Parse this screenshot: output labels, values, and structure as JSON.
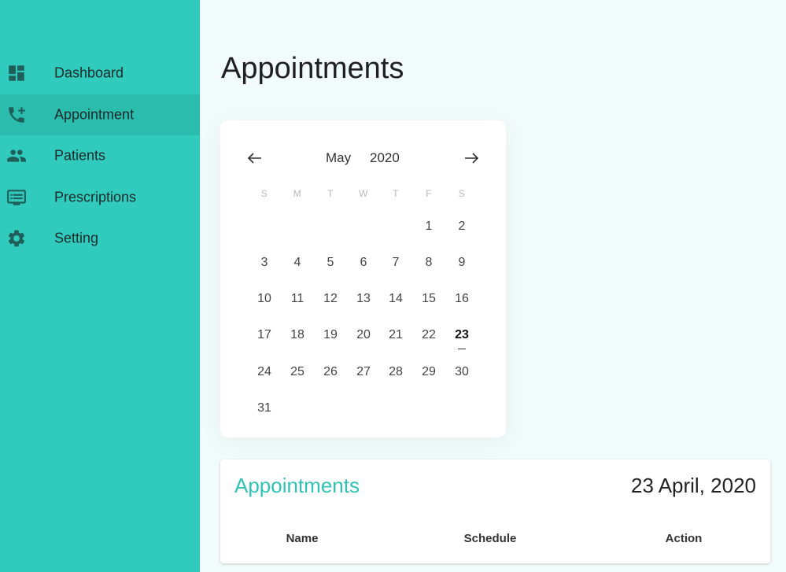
{
  "sidebar": {
    "items": [
      {
        "label": "Dashboard",
        "icon": "dashboard-icon",
        "active": false
      },
      {
        "label": "Appointment",
        "icon": "phone-add-icon",
        "active": true
      },
      {
        "label": "Patients",
        "icon": "people-icon",
        "active": false
      },
      {
        "label": "Prescriptions",
        "icon": "monitor-list-icon",
        "active": false
      },
      {
        "label": "Setting",
        "icon": "gear-icon",
        "active": false
      }
    ]
  },
  "page": {
    "title": "Appointments"
  },
  "calendar": {
    "month": "May",
    "year": "2020",
    "weekdays": [
      "S",
      "M",
      "T",
      "W",
      "T",
      "F",
      "S"
    ],
    "selected_day": "23",
    "weeks": [
      [
        "",
        "",
        "",
        "",
        "",
        "1",
        "2"
      ],
      [
        "3",
        "4",
        "5",
        "6",
        "7",
        "8",
        "9"
      ],
      [
        "10",
        "11",
        "12",
        "13",
        "14",
        "15",
        "16"
      ],
      [
        "17",
        "18",
        "19",
        "20",
        "21",
        "22",
        "23"
      ],
      [
        "24",
        "25",
        "26",
        "27",
        "28",
        "29",
        "30"
      ],
      [
        "31",
        "",
        "",
        "",
        "",
        "",
        ""
      ]
    ]
  },
  "appointments": {
    "title": "Appointments",
    "date": "23 April, 2020",
    "columns": [
      "Name",
      "Schedule",
      "Action"
    ]
  },
  "colors": {
    "sidebar": "#30cbbd",
    "sidebar_active": "#2bbcae",
    "accent_text": "#30c2b4",
    "background": "#f1fbf9"
  }
}
